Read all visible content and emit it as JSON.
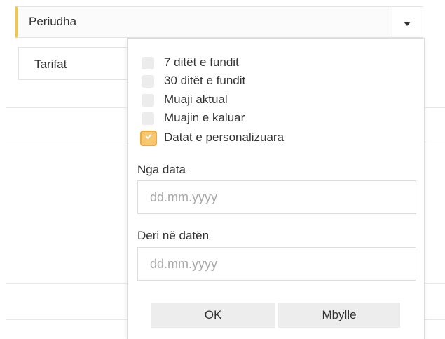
{
  "filters": {
    "period_label": "Periudha",
    "period_toggle_icon": "chevron-down-icon",
    "tariff_label": "Tarifat"
  },
  "dropdown": {
    "options": [
      {
        "label": "7 ditët e fundit",
        "checked": false
      },
      {
        "label": "30 ditët e fundit",
        "checked": false
      },
      {
        "label": "Muaji aktual",
        "checked": false
      },
      {
        "label": "Muajin e kaluar",
        "checked": false
      },
      {
        "label": "Datat e personalizuara",
        "checked": true
      }
    ],
    "from_label": "Nga data",
    "from_placeholder": "dd.mm.yyyy",
    "to_label": "Deri në datën",
    "to_placeholder": "dd.mm.yyyy",
    "ok_label": "OK",
    "close_label": "Mbylle"
  },
  "colors": {
    "accent": "#f0c455",
    "checked_fill": "#f7c870",
    "checked_border": "#f0a93a",
    "button_bg": "#ededed"
  }
}
